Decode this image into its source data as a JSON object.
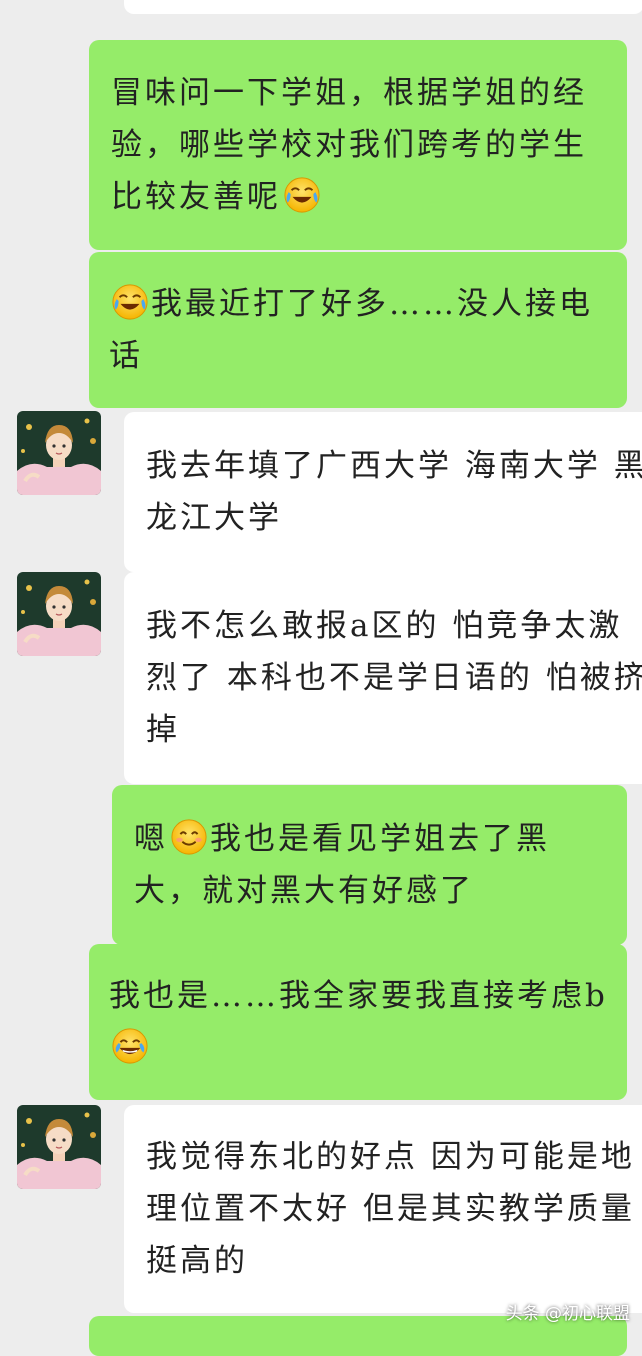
{
  "chat": {
    "messages": [
      {
        "side": "sent",
        "text_before": "冒味问一下学姐，根据学姐的经验，哪些学校对我们跨考的学生比较友善呢",
        "emoji": "crying-laughing-emoji",
        "text_after": ""
      },
      {
        "side": "sent",
        "text_before": "",
        "emoji": "crying-laughing-emoji",
        "text_after": "我最近打了好多……没人接电话"
      },
      {
        "side": "received",
        "text": "我去年填了广西大学 海南大学 黑龙江大学"
      },
      {
        "side": "received",
        "text": "我不怎么敢报a区的 怕竞争太激烈了 本科也不是学日语的 怕被挤掉"
      },
      {
        "side": "sent",
        "text_before": "嗯",
        "emoji": "smiling-face-emoji",
        "text_after": "我也是看见学姐去了黑大，就对黑大有好感了"
      },
      {
        "side": "sent",
        "text_before": "我也是……我全家要我直接考虑b",
        "emoji": "tears-of-joy-emoji",
        "text_after": ""
      },
      {
        "side": "received",
        "text": "我觉得东北的好点 因为可能是地理位置不太好 但是其实教学质量挺高的"
      }
    ]
  },
  "watermark": "头条 @初心联盟",
  "colors": {
    "background": "#ededed",
    "sent_bubble": "#95ec69",
    "received_bubble": "#ffffff"
  }
}
